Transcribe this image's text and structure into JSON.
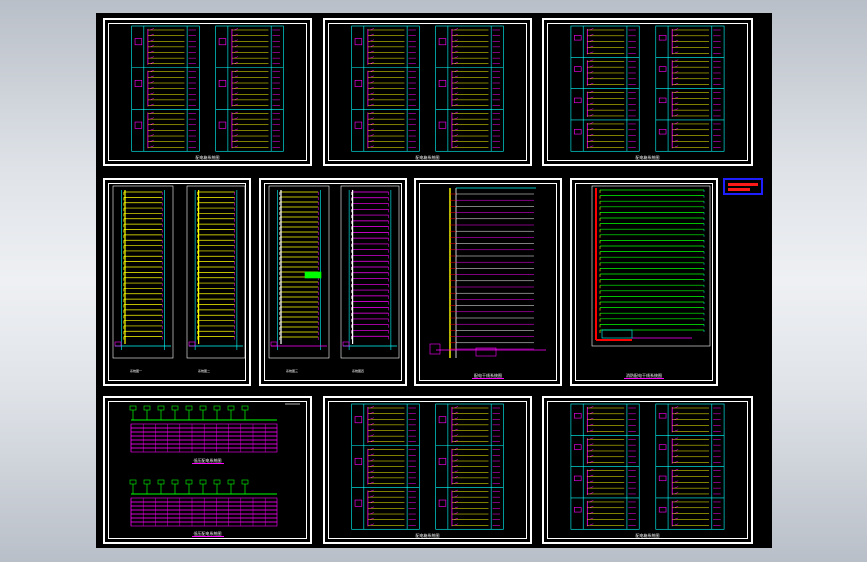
{
  "window": {
    "title": ""
  },
  "viewport": {
    "background": "#000000",
    "border": "#ffffff"
  },
  "colors": {
    "cyan": "#00ffff",
    "magenta": "#ff00ff",
    "yellow": "#ffff00",
    "green": "#00ff00",
    "red": "#ff0000",
    "white": "#ffffff",
    "blue": "#1e1eff"
  },
  "sheets": [
    {
      "id": "row1-left",
      "caption": "配电箱系统图",
      "style": "schedule"
    },
    {
      "id": "row1-mid",
      "caption": "配电箱系统图",
      "style": "schedule"
    },
    {
      "id": "row1-right",
      "caption": "配电箱系统图",
      "style": "schedule-small"
    },
    {
      "id": "row2-a",
      "caption_left": "系统图一",
      "caption_right": "系统图二",
      "style": "riser-yellow"
    },
    {
      "id": "row2-b",
      "caption_left": "系统图三",
      "caption_right": "系统图四",
      "style": "riser-mixed"
    },
    {
      "id": "row2-c",
      "caption": "配电干线系统图",
      "style": "riser-tree"
    },
    {
      "id": "row2-d",
      "caption": "消防配电干线系统图",
      "style": "riser-green"
    },
    {
      "id": "row3-left",
      "caption_top": "低压配电系统图",
      "caption_bottom": "低压配电系统图",
      "style": "switchboard"
    },
    {
      "id": "row3-mid",
      "caption": "配电箱系统图",
      "style": "schedule"
    },
    {
      "id": "row3-right",
      "caption": "配电箱系统图",
      "style": "schedule-small"
    }
  ],
  "stamp": {
    "icon": "title-stamp-icon"
  }
}
